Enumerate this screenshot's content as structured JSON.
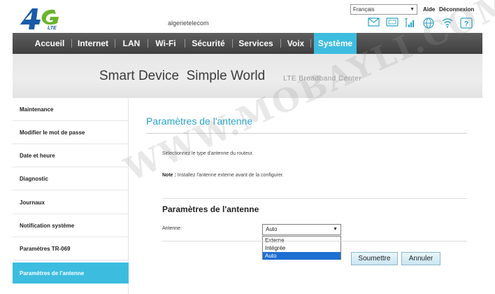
{
  "header": {
    "brand_main": "4G",
    "brand_sub": "LTE",
    "site_name": "algerietelecom",
    "language": "Français",
    "links": {
      "help": "Aide",
      "logout": "Déconnexion"
    },
    "status_icons": [
      "sms-icon",
      "sim-icon",
      "signal-icon",
      "internet-icon",
      "wifi-icon",
      "help-icon"
    ]
  },
  "nav": {
    "items": [
      "Accueil",
      "Internet",
      "LAN",
      "Wi-Fi",
      "Sécurité",
      "Services",
      "Voix",
      "Système"
    ],
    "active": "Système"
  },
  "banner": {
    "main": "Smart Device  Simple World",
    "sub": "LTE Broadband Center"
  },
  "sidebar": {
    "items": [
      "Maintenance",
      "Modifier le mot de passe",
      "Date et heure",
      "Diagnostic",
      "Journaux",
      "Notification système",
      "Paramètres TR-069",
      "Paramètres de l'antenne"
    ],
    "active": "Paramètres de l'antenne"
  },
  "content": {
    "title": "Paramètres de l'antenne",
    "instruction": "Sélectionnez le type d'antenne du routeur.",
    "note_label": "Note :",
    "note_text": " Installez l'antenne externe avant de la configurer.",
    "section_title": "Paramètres de l'antenne",
    "antenna_label": "Antenne:",
    "antenna_value": "Auto",
    "antenna_options": [
      "Externe",
      "Intégrée",
      "Auto"
    ],
    "antenna_highlighted": "Auto",
    "submit": "Soumettre",
    "cancel": "Annuler"
  },
  "watermark": "WWW.MOBAYLI.COM",
  "colors": {
    "accent": "#3cbde0",
    "title": "#2aa3c8",
    "nav_bg": "#4a4a4a",
    "selected_option": "#1d6fd1"
  }
}
